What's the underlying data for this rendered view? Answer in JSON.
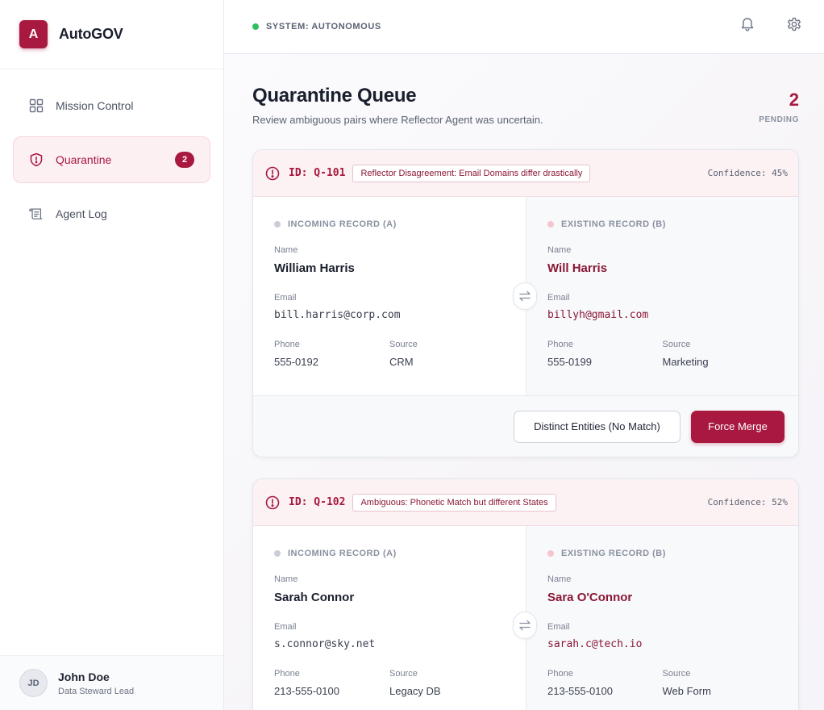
{
  "brand": {
    "logo_letter": "A",
    "name": "AutoGOV",
    "accent": "#a8183f"
  },
  "nav": [
    {
      "label": "Mission Control",
      "icon": "grid-icon",
      "active": false
    },
    {
      "label": "Quarantine",
      "icon": "shield-alert-icon",
      "active": true,
      "badge": "2"
    },
    {
      "label": "Agent Log",
      "icon": "scroll-icon",
      "active": false
    }
  ],
  "user": {
    "initials": "JD",
    "name": "John Doe",
    "role": "Data Steward Lead"
  },
  "topbar": {
    "status": "SYSTEM: AUTONOMOUS",
    "status_color": "#2fbf62"
  },
  "page": {
    "title": "Quarantine Queue",
    "subtitle": "Review ambiguous pairs where Reflector Agent was uncertain.",
    "pending_count": "2",
    "pending_label": "PENDING"
  },
  "labels": {
    "incoming": "INCOMING RECORD (A)",
    "existing": "EXISTING RECORD (B)",
    "name": "Name",
    "email": "Email",
    "phone": "Phone",
    "source": "Source",
    "distinct_button": "Distinct Entities (No Match)",
    "merge_button": "Force Merge"
  },
  "items": [
    {
      "id": "ID: Q-101",
      "reason": "Reflector Disagreement: Email Domains differ drastically",
      "confidence": "Confidence: 45%",
      "a": {
        "name": "William Harris",
        "email": "bill.harris@corp.com",
        "phone": "555-0192",
        "source": "CRM"
      },
      "b": {
        "name": "Will Harris",
        "email": "billyh@gmail.com",
        "phone": "555-0199",
        "source": "Marketing"
      }
    },
    {
      "id": "ID: Q-102",
      "reason": "Ambiguous: Phonetic Match but different States",
      "confidence": "Confidence: 52%",
      "a": {
        "name": "Sarah Connor",
        "email": "s.connor@sky.net",
        "phone": "213-555-0100",
        "source": "Legacy DB"
      },
      "b": {
        "name": "Sara O'Connor",
        "email": "sarah.c@tech.io",
        "phone": "213-555-0100",
        "source": "Web Form"
      }
    }
  ]
}
